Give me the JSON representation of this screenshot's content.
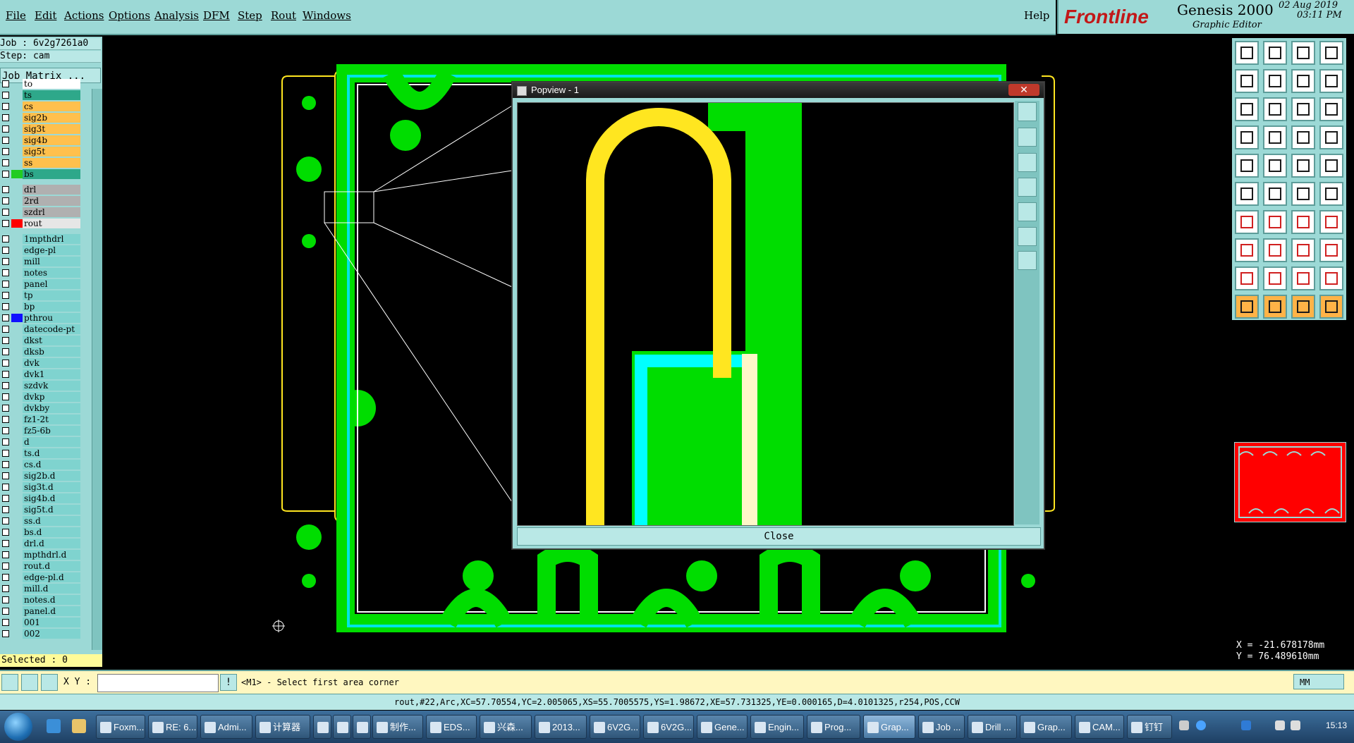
{
  "menubar": {
    "items": [
      "File",
      "Edit",
      "Actions",
      "Options",
      "Analysis",
      "DFM",
      "Step",
      "Rout",
      "Windows"
    ],
    "help": "Help"
  },
  "brand": {
    "logo": "Frontline",
    "product": "Genesis 2000",
    "subtitle": "Graphic Editor",
    "date": "02 Aug 2019",
    "time": "03:11 PM"
  },
  "left_panel": {
    "job": "Job : 6v2g7261a0",
    "step": "Step: cam",
    "job_matrix": "Job Matrix ...",
    "layers": [
      {
        "name": "to",
        "color": "#ffffff",
        "swatch": ""
      },
      {
        "name": "ts",
        "color": "#2ea88a",
        "swatch": ""
      },
      {
        "name": "cs",
        "color": "#ffc04d",
        "swatch": ""
      },
      {
        "name": "sig2b",
        "color": "#ffc04d",
        "swatch": ""
      },
      {
        "name": "sig3t",
        "color": "#ffc04d",
        "swatch": ""
      },
      {
        "name": "sig4b",
        "color": "#ffc04d",
        "swatch": ""
      },
      {
        "name": "sig5t",
        "color": "#ffc04d",
        "swatch": ""
      },
      {
        "name": "ss",
        "color": "#ffc04d",
        "swatch": ""
      },
      {
        "name": "bs",
        "color": "#2ea88a",
        "swatch": "#22cc22"
      },
      {
        "name": "drl",
        "color": "#b0b0b0",
        "swatch": ""
      },
      {
        "name": "2rd",
        "color": "#b0b0b0",
        "swatch": ""
      },
      {
        "name": "szdrl",
        "color": "#b0b0b0",
        "swatch": ""
      },
      {
        "name": "rout",
        "color": "#e6e6e6",
        "swatch": "#ff0000"
      },
      {
        "name": "1mpthdrl",
        "color": "#7fd3cf",
        "swatch": ""
      },
      {
        "name": "edge-pl",
        "color": "#7fd3cf",
        "swatch": ""
      },
      {
        "name": "mill",
        "color": "#7fd3cf",
        "swatch": ""
      },
      {
        "name": "notes",
        "color": "#7fd3cf",
        "swatch": ""
      },
      {
        "name": "panel",
        "color": "#7fd3cf",
        "swatch": ""
      },
      {
        "name": "tp",
        "color": "#7fd3cf",
        "swatch": ""
      },
      {
        "name": "bp",
        "color": "#7fd3cf",
        "swatch": ""
      },
      {
        "name": "pthrou",
        "color": "#7fd3cf",
        "swatch": "#1010ff"
      },
      {
        "name": "datecode-pt",
        "color": "#7fd3cf",
        "swatch": ""
      },
      {
        "name": "dkst",
        "color": "#7fd3cf",
        "swatch": ""
      },
      {
        "name": "dksb",
        "color": "#7fd3cf",
        "swatch": ""
      },
      {
        "name": "dvk",
        "color": "#7fd3cf",
        "swatch": ""
      },
      {
        "name": "dvk1",
        "color": "#7fd3cf",
        "swatch": ""
      },
      {
        "name": "szdvk",
        "color": "#7fd3cf",
        "swatch": ""
      },
      {
        "name": "dvkp",
        "color": "#7fd3cf",
        "swatch": ""
      },
      {
        "name": "dvkby",
        "color": "#7fd3cf",
        "swatch": ""
      },
      {
        "name": "fz1-2t",
        "color": "#7fd3cf",
        "swatch": ""
      },
      {
        "name": "fz5-6b",
        "color": "#7fd3cf",
        "swatch": ""
      },
      {
        "name": "d",
        "color": "#7fd3cf",
        "swatch": ""
      },
      {
        "name": "ts.d",
        "color": "#7fd3cf",
        "swatch": ""
      },
      {
        "name": "cs.d",
        "color": "#7fd3cf",
        "swatch": ""
      },
      {
        "name": "sig2b.d",
        "color": "#7fd3cf",
        "swatch": ""
      },
      {
        "name": "sig3t.d",
        "color": "#7fd3cf",
        "swatch": ""
      },
      {
        "name": "sig4b.d",
        "color": "#7fd3cf",
        "swatch": ""
      },
      {
        "name": "sig5t.d",
        "color": "#7fd3cf",
        "swatch": ""
      },
      {
        "name": "ss.d",
        "color": "#7fd3cf",
        "swatch": ""
      },
      {
        "name": "bs.d",
        "color": "#7fd3cf",
        "swatch": ""
      },
      {
        "name": "drl.d",
        "color": "#7fd3cf",
        "swatch": ""
      },
      {
        "name": "mpthdrl.d",
        "color": "#7fd3cf",
        "swatch": ""
      },
      {
        "name": "rout.d",
        "color": "#7fd3cf",
        "swatch": ""
      },
      {
        "name": "edge-pl.d",
        "color": "#7fd3cf",
        "swatch": ""
      },
      {
        "name": "mill.d",
        "color": "#7fd3cf",
        "swatch": ""
      },
      {
        "name": "notes.d",
        "color": "#7fd3cf",
        "swatch": ""
      },
      {
        "name": "panel.d",
        "color": "#7fd3cf",
        "swatch": ""
      },
      {
        "name": "001",
        "color": "#7fd3cf",
        "swatch": ""
      },
      {
        "name": "002",
        "color": "#7fd3cf",
        "swatch": ""
      }
    ],
    "selected": "Selected : 0"
  },
  "popview": {
    "title": "Popview - 1",
    "close_x": "✕",
    "close_label": "Close"
  },
  "coords": {
    "x": "X = -21.678178mm",
    "y": "Y = 76.489610mm"
  },
  "command": {
    "xy_label": "X Y :",
    "xy_value": "",
    "prompt": "<M1> - Select first area corner",
    "units": "MM"
  },
  "status": "rout,#22,Arc,XC=57.70554,YC=2.005065,XS=55.7005575,YS=1.98672,XE=57.731325,YE=0.000165,D=4.0101325,r254,POS,CCW",
  "taskbar": {
    "tasks": [
      "Foxm...",
      "RE: 6...",
      "Admi...",
      "计算器",
      "",
      "",
      "",
      "制作...",
      "EDS...",
      "兴森...",
      "2013...",
      "6V2G...",
      "6V2G...",
      "Gene...",
      "Engin...",
      "Prog...",
      "Grap...",
      "Job ...",
      "Drill ...",
      "Grap...",
      "CAM...",
      "钉钉"
    ],
    "clock": "15:13"
  },
  "colors": {
    "ui_teal": "#9cd9d6",
    "copper_green": "#00dd00",
    "outline_yellow": "#ffe620",
    "pad_cyan": "#00ffff",
    "rout_red": "#ff0000"
  }
}
